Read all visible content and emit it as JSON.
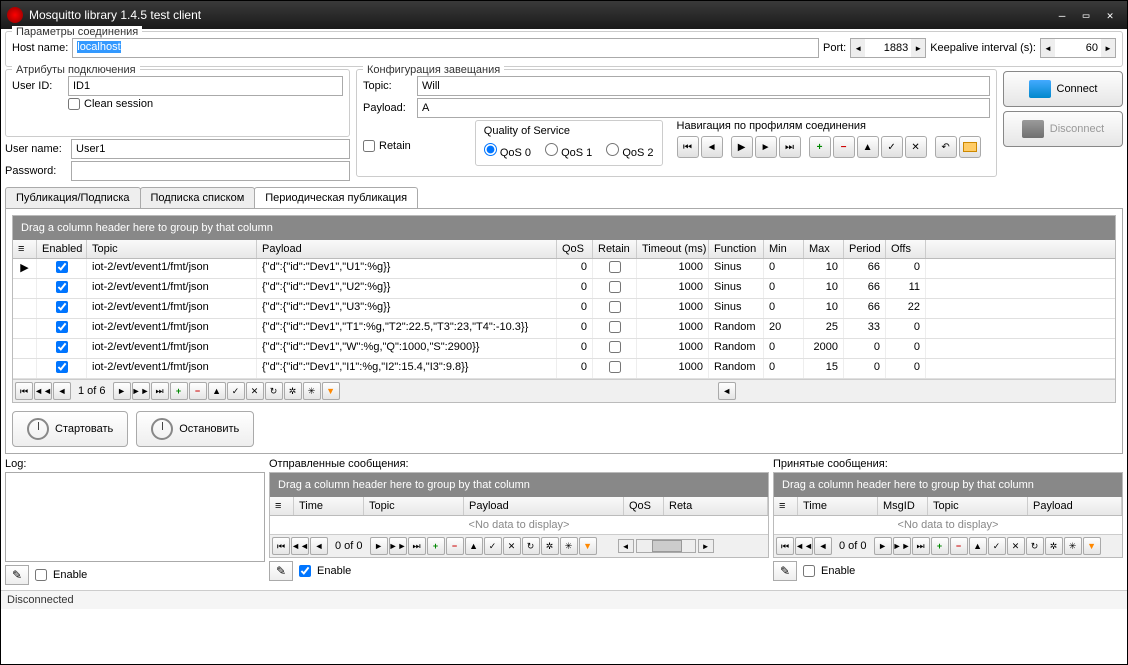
{
  "window": {
    "title": "Mosquitto library 1.4.5 test client"
  },
  "conn_params": {
    "title": "Параметры соединения",
    "host_label": "Host name:",
    "host_value": "localhost",
    "port_label": "Port:",
    "port_value": "1883",
    "keepalive_label": "Keepalive interval (s):",
    "keepalive_value": "60"
  },
  "attrs": {
    "title": "Атрибуты подключения",
    "userid_label": "User ID:",
    "userid_value": "ID1",
    "clean_label": "Clean session",
    "username_label": "User name:",
    "username_value": "User1",
    "password_label": "Password:",
    "password_value": ""
  },
  "will": {
    "title": "Конфигурация завещания",
    "topic_label": "Topic:",
    "topic_value": "Will",
    "payload_label": "Payload:",
    "payload_value": "A",
    "retain_label": "Retain",
    "qos_title": "Quality of Service",
    "qos0": "QoS 0",
    "qos1": "QoS 1",
    "qos2": "QoS 2",
    "nav_title": "Навигация по профилям соединения"
  },
  "buttons": {
    "connect": "Connect",
    "disconnect": "Disconnect",
    "start": "Стартовать",
    "stop": "Остановить"
  },
  "tabs": {
    "t1": "Публикация/Подписка",
    "t2": "Подписка списком",
    "t3": "Периодическая публикация"
  },
  "grid": {
    "group_hint": "Drag a column header here to group by that column",
    "cols": {
      "enabled": "Enabled",
      "topic": "Topic",
      "payload": "Payload",
      "qos": "QoS",
      "retain": "Retain",
      "timeout": "Timeout (ms)",
      "function": "Function",
      "min": "Min",
      "max": "Max",
      "period": "Period",
      "offs": "Offs"
    },
    "rows": [
      {
        "enabled": true,
        "topic": "iot-2/evt/event1/fmt/json",
        "payload": "{\"d\":{\"id\":\"Dev1\",\"U1\":%g}}",
        "qos": "0",
        "retain": false,
        "timeout": "1000",
        "function": "Sinus",
        "min": "0",
        "max": "10",
        "period": "66",
        "offs": "0"
      },
      {
        "enabled": true,
        "topic": "iot-2/evt/event1/fmt/json",
        "payload": "{\"d\":{\"id\":\"Dev1\",\"U2\":%g}}",
        "qos": "0",
        "retain": false,
        "timeout": "1000",
        "function": "Sinus",
        "min": "0",
        "max": "10",
        "period": "66",
        "offs": "11"
      },
      {
        "enabled": true,
        "topic": "iot-2/evt/event1/fmt/json",
        "payload": "{\"d\":{\"id\":\"Dev1\",\"U3\":%g}}",
        "qos": "0",
        "retain": false,
        "timeout": "1000",
        "function": "Sinus",
        "min": "0",
        "max": "10",
        "period": "66",
        "offs": "22"
      },
      {
        "enabled": true,
        "topic": "iot-2/evt/event1/fmt/json",
        "payload": "{\"d\":{\"id\":\"Dev1\",\"T1\":%g,\"T2\":22.5,\"T3\":23,\"T4\":-10.3}}",
        "qos": "0",
        "retain": false,
        "timeout": "1000",
        "function": "Random",
        "min": "20",
        "max": "25",
        "period": "33",
        "offs": "0"
      },
      {
        "enabled": true,
        "topic": "iot-2/evt/event1/fmt/json",
        "payload": "{\"d\":{\"id\":\"Dev1\",\"W\":%g,\"Q\":1000,\"S\":2900}}",
        "qos": "0",
        "retain": false,
        "timeout": "1000",
        "function": "Random",
        "min": "0",
        "max": "2000",
        "period": "0",
        "offs": "0"
      },
      {
        "enabled": true,
        "topic": "iot-2/evt/event1/fmt/json",
        "payload": "{\"d\":{\"id\":\"Dev1\",\"I1\":%g,\"I2\":15.4,\"I3\":9.8}}",
        "qos": "0",
        "retain": false,
        "timeout": "1000",
        "function": "Random",
        "min": "0",
        "max": "15",
        "period": "0",
        "offs": "0"
      }
    ],
    "page_info": "1 of 6"
  },
  "log": {
    "label": "Log:"
  },
  "sent": {
    "label": "Отправленные сообщения:",
    "cols": {
      "time": "Time",
      "topic": "Topic",
      "payload": "Payload",
      "qos": "QoS",
      "retain": "Reta"
    },
    "nodata": "<No data to display>",
    "page_info": "0 of 0",
    "enable": "Enable"
  },
  "recv": {
    "label": "Принятые сообщения:",
    "cols": {
      "time": "Time",
      "msgid": "MsgID",
      "topic": "Topic",
      "payload": "Payload"
    },
    "nodata": "<No data to display>",
    "page_info": "0 of 0",
    "enable": "Enable"
  },
  "enable_label": "Enable",
  "status": "Disconnected"
}
